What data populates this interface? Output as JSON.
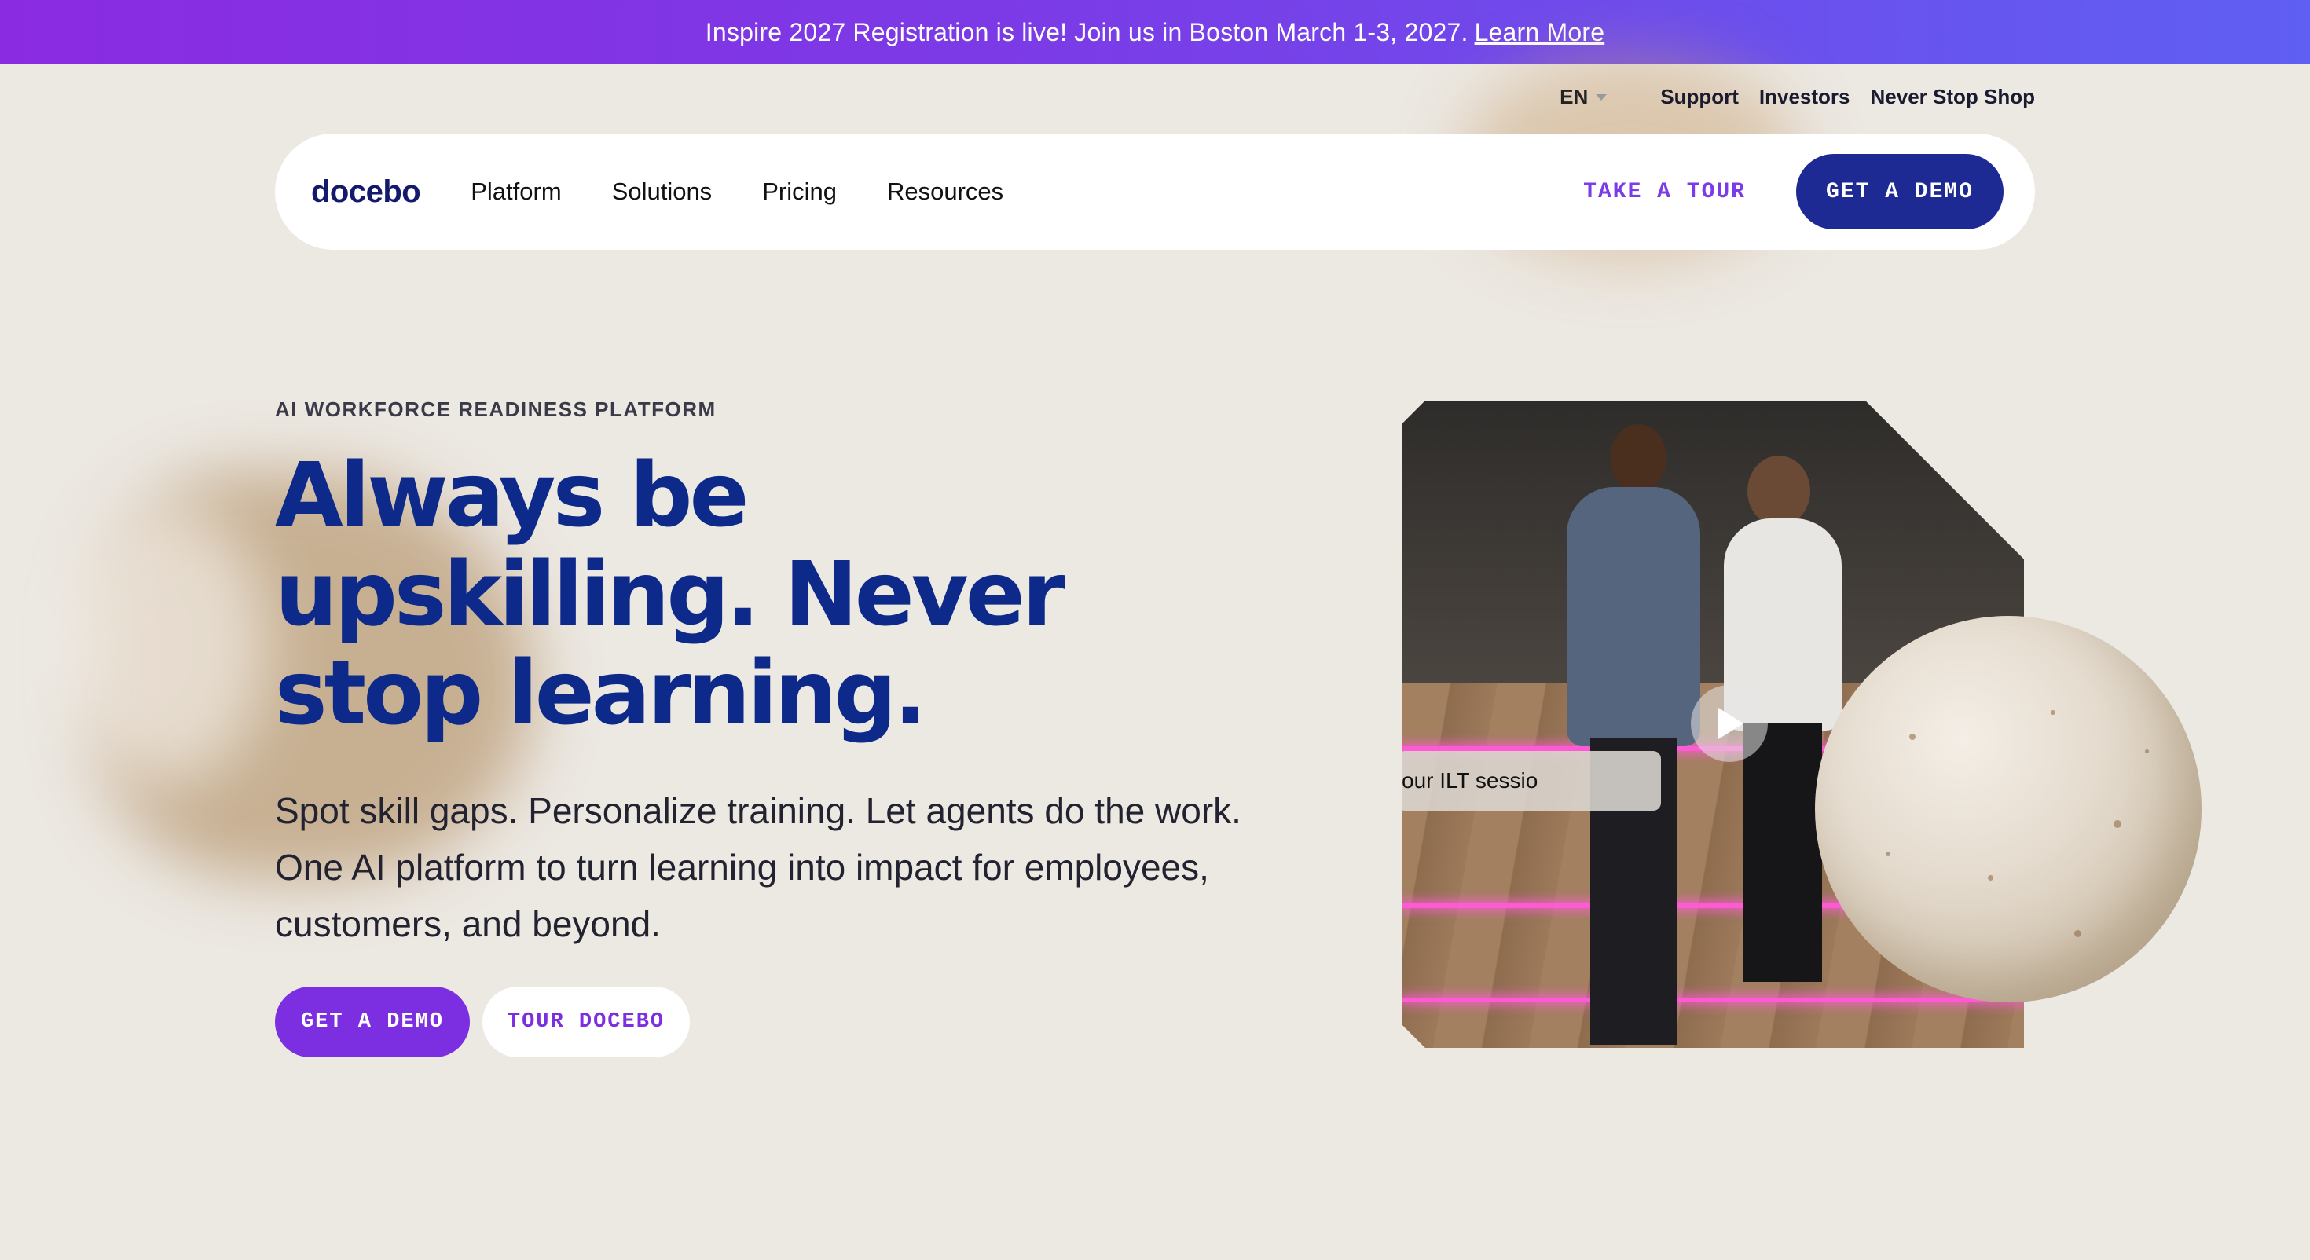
{
  "announcement": {
    "text": "Inspire 2027 Registration is live! Join us in Boston March 1-3, 2027.",
    "link_label": "Learn More"
  },
  "utility_nav": {
    "language": "EN",
    "links": [
      "Support",
      "Investors",
      "Never Stop Shop"
    ]
  },
  "main_nav": {
    "logo": "docebo",
    "links": [
      "Platform",
      "Solutions",
      "Pricing",
      "Resources"
    ],
    "take_tour_label": "TAKE A TOUR",
    "get_demo_label": "GET A DEMO"
  },
  "hero": {
    "eyebrow": "AI WORKFORCE READINESS PLATFORM",
    "headline_lines": [
      "Always be",
      "upskilling. Never",
      "stop learning."
    ],
    "subcopy_lines": [
      "Spot skill gaps. Personalize training. Let agents do the work.",
      "One AI platform to turn learning into impact for employees,",
      "customers, and beyond."
    ],
    "primary_cta": "GET A DEMO",
    "secondary_cta": "TOUR DOCEBO"
  },
  "video": {
    "caption": "our ILT sessio"
  },
  "colors": {
    "brand_navy": "#0d2a8a",
    "brand_purple": "#7b2fe0",
    "background": "#ece8e2"
  }
}
